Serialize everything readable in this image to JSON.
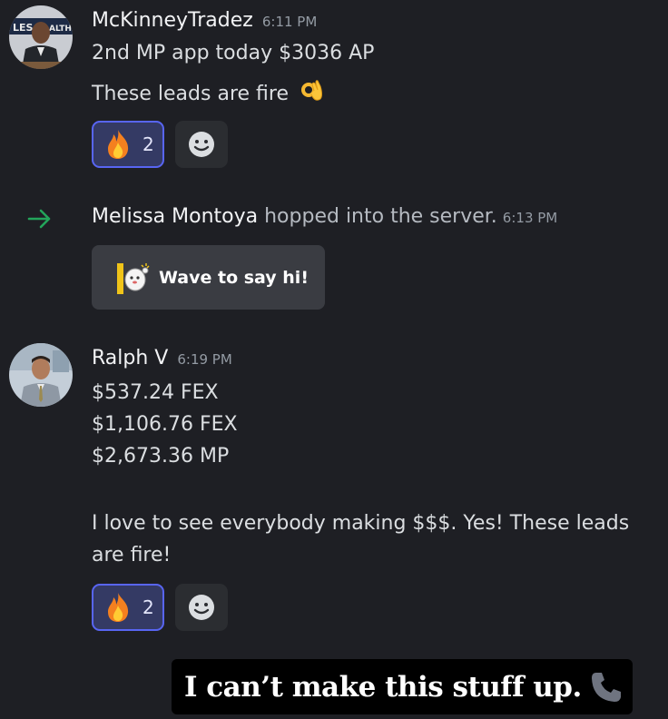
{
  "messages": [
    {
      "author": "McKinneyTradez",
      "time": "6:11 PM",
      "avatar_icon": "profile-photo",
      "lines": [
        "2nd MP app today $3036 AP",
        "These leads are fire"
      ],
      "inline_emoji": "ok-hand-emoji",
      "reaction": {
        "emoji": "fire-emoji",
        "count": "2"
      }
    },
    {
      "author": "Ralph V",
      "time": "6:19 PM",
      "avatar_icon": "profile-photo",
      "lines": [
        "$537.24 FEX",
        "$1,106.76 FEX",
        "$2,673.36 MP",
        "I love to see everybody making $$$. Yes! These leads",
        "are fire!"
      ],
      "reaction": {
        "emoji": "fire-emoji",
        "count": "2"
      }
    }
  ],
  "join_event": {
    "name": "Melissa Montoya",
    "text": " hopped into the server.",
    "time": "6:13 PM",
    "icon": "join-arrow-icon",
    "icon_color": "#23a55a"
  },
  "wave_button": {
    "label": "Wave to say hi!",
    "icon": "wave-sticker-icon"
  },
  "add_reaction_icon": "smiley-add-reaction-icon",
  "caption": {
    "text": "I can’t make this stuff up.",
    "icon": "telephone-icon"
  },
  "colors": {
    "background": "#1e1f24",
    "reaction_bg": "#343a64",
    "reaction_border": "#5865f2",
    "button_bg": "#3a3c42"
  }
}
